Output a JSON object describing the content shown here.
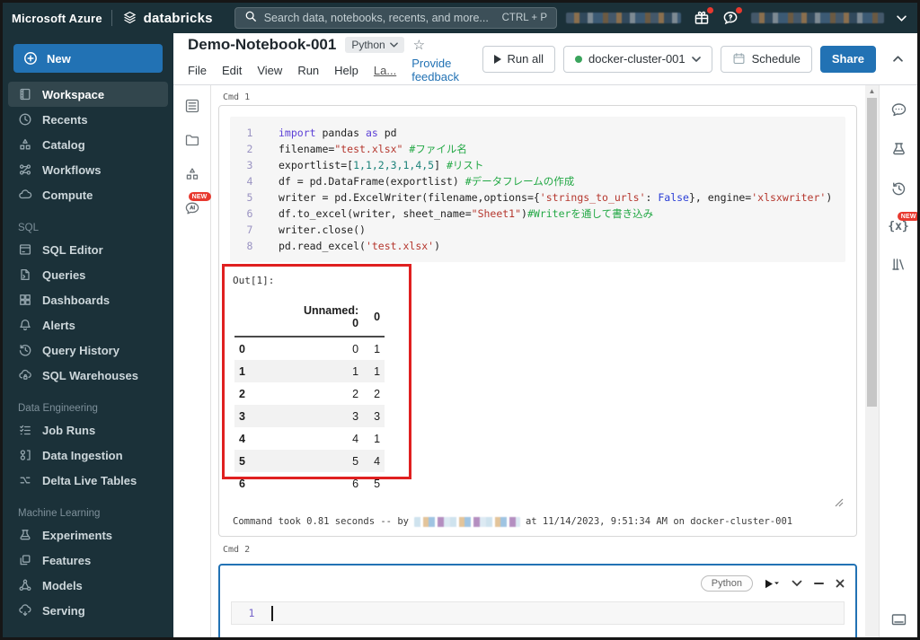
{
  "colors": {
    "accent": "#2272b4",
    "annotation_red": "#e02020",
    "badge_red": "#e8392f",
    "cluster_green": "#3ba45d",
    "dark_chrome": "#1b3139"
  },
  "topbar": {
    "azure": "Microsoft Azure",
    "brand": "databricks",
    "search_placeholder": "Search data, notebooks, recents, and more...",
    "search_shortcut": "CTRL + P"
  },
  "badges": {
    "new": "NEW"
  },
  "sidebar": {
    "new_label": "New",
    "main_items": [
      "Workspace",
      "Recents",
      "Catalog",
      "Workflows",
      "Compute"
    ],
    "sections": [
      {
        "header": "SQL",
        "items": [
          "SQL Editor",
          "Queries",
          "Dashboards",
          "Alerts",
          "Query History",
          "SQL Warehouses"
        ]
      },
      {
        "header": "Data Engineering",
        "items": [
          "Job Runs",
          "Data Ingestion",
          "Delta Live Tables"
        ]
      },
      {
        "header": "Machine Learning",
        "items": [
          "Experiments",
          "Features",
          "Models",
          "Serving"
        ]
      }
    ]
  },
  "notebook": {
    "title": "Demo-Notebook-001",
    "language": "Python",
    "menu": [
      "File",
      "Edit",
      "View",
      "Run",
      "Help",
      "La..."
    ],
    "feedback_link": "Provide feedback",
    "run_all": "Run all",
    "cluster": "docker-cluster-001",
    "schedule": "Schedule",
    "share": "Share"
  },
  "cell1": {
    "label": "Cmd 1",
    "code": {
      "lines": [
        {
          "n": "1",
          "t": [
            "import",
            " pandas ",
            "as",
            " pd"
          ]
        },
        {
          "n": "2",
          "t": [
            "filename=",
            "\"test.xlsx\"",
            " ",
            "#ファイル名"
          ]
        },
        {
          "n": "3",
          "t": [
            "exportlist=[",
            "1,1,2,3,1,4,5",
            "] ",
            "#リスト"
          ]
        },
        {
          "n": "4",
          "t": [
            "df = pd.DataFrame(exportlist) ",
            "#データフレームの作成"
          ]
        },
        {
          "n": "5",
          "t": [
            "writer = pd.ExcelWriter(filename,options={",
            "'strings_to_urls'",
            ": ",
            "False",
            "}, engine=",
            "'xlsxwriter'",
            ")"
          ]
        },
        {
          "n": "6",
          "t": [
            "df.to_excel(writer, sheet_name=",
            "\"Sheet1\"",
            ")",
            "#Writerを通して書き込み"
          ]
        },
        {
          "n": "7",
          "t": [
            "writer.close()"
          ]
        },
        {
          "n": "8",
          "t": [
            "pd.read_excel(",
            "'test.xlsx'",
            ")"
          ]
        }
      ]
    },
    "out_label": "Out[1]:",
    "table": {
      "headers": [
        "Unnamed: 0",
        "0"
      ],
      "rows": [
        [
          "0",
          "0",
          "1"
        ],
        [
          "1",
          "1",
          "1"
        ],
        [
          "2",
          "2",
          "2"
        ],
        [
          "3",
          "3",
          "3"
        ],
        [
          "4",
          "4",
          "1"
        ],
        [
          "5",
          "5",
          "4"
        ],
        [
          "6",
          "6",
          "5"
        ]
      ]
    },
    "status": {
      "prefix": "Command took 0.81 seconds -- by",
      "suffix": "at 11/14/2023, 9:51:34 AM on docker-cluster-001"
    }
  },
  "cell2": {
    "label": "Cmd 2",
    "language": "Python",
    "line_number": "1"
  }
}
